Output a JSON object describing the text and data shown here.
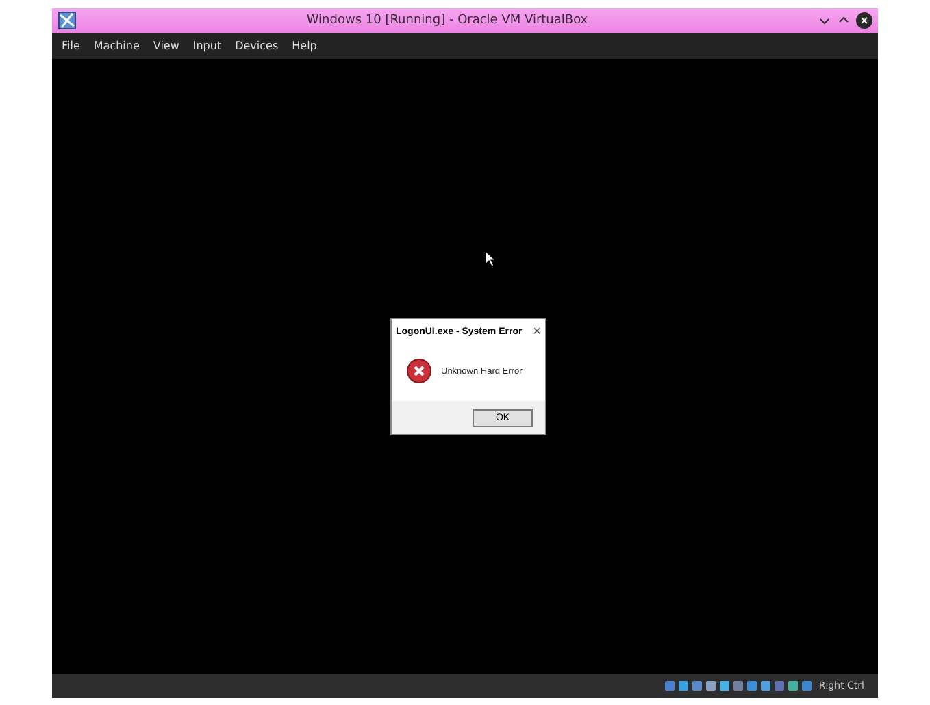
{
  "window": {
    "title": "Windows 10 [Running] - Oracle VM VirtualBox"
  },
  "menu": [
    "File",
    "Machine",
    "View",
    "Input",
    "Devices",
    "Help"
  ],
  "dialog": {
    "title": "LogonUI.exe - System Error",
    "message": "Unknown Hard Error",
    "close": "×",
    "buttons": [
      "OK"
    ]
  },
  "status_bar": {
    "host_key": "Right Ctrl"
  }
}
